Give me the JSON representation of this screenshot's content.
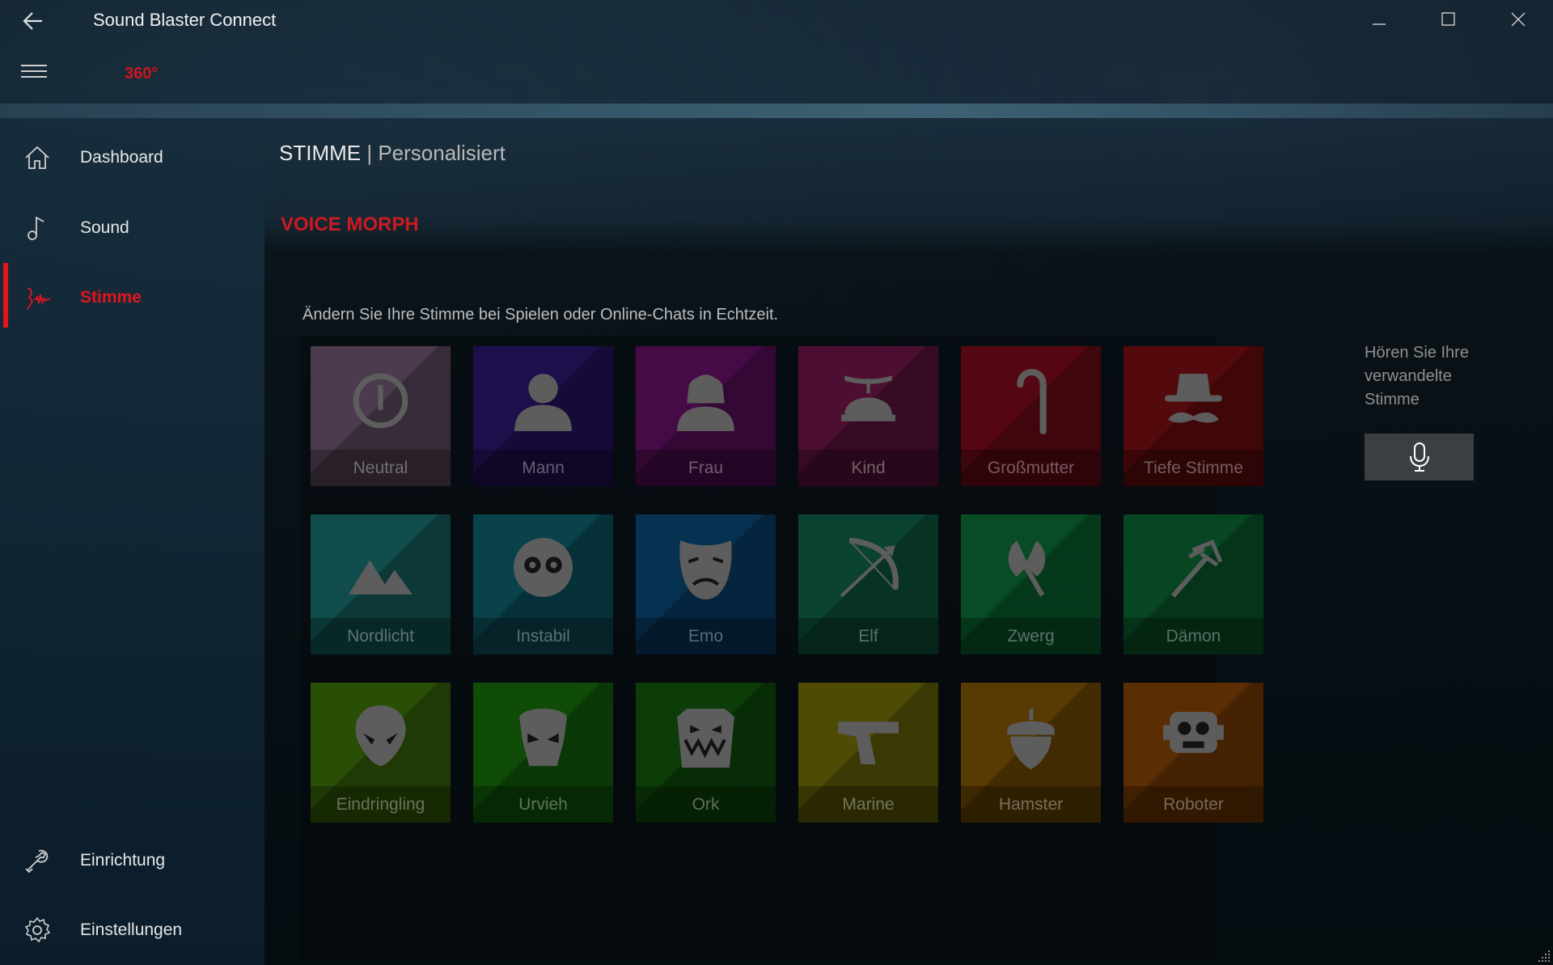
{
  "window": {
    "title": "Sound Blaster Connect",
    "logo_text": "360°"
  },
  "sidebar": {
    "items": [
      {
        "label": "Dashboard",
        "icon": "home-icon"
      },
      {
        "label": "Sound",
        "icon": "music-note-icon"
      },
      {
        "label": "Stimme",
        "icon": "voice-icon",
        "active": true
      },
      {
        "label": "Einrichtung",
        "icon": "wrench-icon"
      },
      {
        "label": "Einstellungen",
        "icon": "gear-icon"
      }
    ]
  },
  "breadcrumb": {
    "main": "STIMME",
    "separator": "|",
    "sub": "Personalisiert"
  },
  "section": {
    "title": "VOICE MORPH",
    "description": "Ändern Sie Ihre Stimme bei Spielen oder Online-Chats in Echtzeit."
  },
  "voices": [
    {
      "label": "Neutral",
      "icon": "power-icon",
      "color": "#8a6a8e"
    },
    {
      "label": "Mann",
      "icon": "man-icon",
      "color": "#3a1a8a"
    },
    {
      "label": "Frau",
      "icon": "woman-icon",
      "color": "#7d1480"
    },
    {
      "label": "Kind",
      "icon": "propeller-cap-icon",
      "color": "#8a1c5a"
    },
    {
      "label": "Großmutter",
      "icon": "cane-icon",
      "color": "#9c1024"
    },
    {
      "label": "Tiefe Stimme",
      "icon": "hat-mustache-icon",
      "color": "#9a1216"
    },
    {
      "label": "Nordlicht",
      "icon": "mountains-icon",
      "color": "#1e8a8a"
    },
    {
      "label": "Instabil",
      "icon": "crazy-eyes-icon",
      "color": "#127888"
    },
    {
      "label": "Emo",
      "icon": "sad-mask-icon",
      "color": "#0e5a94"
    },
    {
      "label": "Elf",
      "icon": "bow-arrow-icon",
      "color": "#137a5a"
    },
    {
      "label": "Zwerg",
      "icon": "axe-icon",
      "color": "#0e8a44"
    },
    {
      "label": "Dämon",
      "icon": "trident-icon",
      "color": "#0e8040"
    },
    {
      "label": "Eindringling",
      "icon": "alien-icon",
      "color": "#4c8e0c"
    },
    {
      "label": "Urvieh",
      "icon": "monster-icon",
      "color": "#1a8a10"
    },
    {
      "label": "Ork",
      "icon": "orc-icon",
      "color": "#166e10"
    },
    {
      "label": "Marine",
      "icon": "pistol-icon",
      "color": "#8e8a08"
    },
    {
      "label": "Hamster",
      "icon": "acorn-icon",
      "color": "#a06a06"
    },
    {
      "label": "Roboter",
      "icon": "robot-icon",
      "color": "#a65206"
    }
  ],
  "preview": {
    "text": "Hören Sie Ihre verwandelte Stimme",
    "icon": "microphone-icon"
  },
  "colors": {
    "accent": "#e3141e",
    "mic_button": "#3a3f43"
  }
}
